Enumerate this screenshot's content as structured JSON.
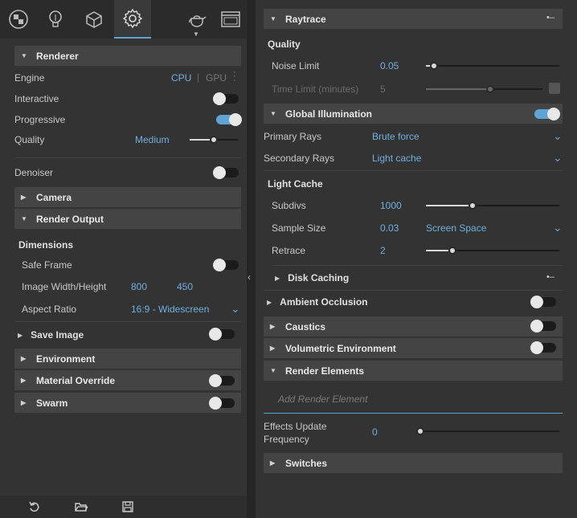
{
  "toolbar": {
    "items": [
      {
        "name": "materials"
      },
      {
        "name": "lights"
      },
      {
        "name": "geometry"
      },
      {
        "name": "settings"
      },
      {
        "name": "teapot"
      },
      {
        "name": "frame-buffer"
      }
    ]
  },
  "left": {
    "renderer": {
      "title": "Renderer",
      "engine_label": "Engine",
      "engine_cpu": "CPU",
      "engine_sep": "|",
      "engine_gpu": "GPU",
      "interactive_label": "Interactive",
      "interactive_on": false,
      "progressive_label": "Progressive",
      "progressive_on": true,
      "quality_label": "Quality",
      "quality_value": "Medium",
      "quality_level": 0.5,
      "denoiser_label": "Denoiser",
      "denoiser_on": false
    },
    "camera": {
      "title": "Camera"
    },
    "render_output": {
      "title": "Render Output",
      "dimensions_label": "Dimensions",
      "safe_frame_label": "Safe Frame",
      "safe_frame_on": false,
      "image_wh_label": "Image Width/Height",
      "width": "800",
      "height": "450",
      "aspect_label": "Aspect Ratio",
      "aspect_value": "16:9 - Widescreen"
    },
    "save_image": {
      "title": "Save Image",
      "on": false
    },
    "environment": {
      "title": "Environment"
    },
    "material_override": {
      "title": "Material Override",
      "on": false
    },
    "swarm": {
      "title": "Swarm",
      "on": false
    }
  },
  "right": {
    "raytrace": {
      "title": "Raytrace",
      "quality_label": "Quality",
      "noise_limit_label": "Noise Limit",
      "noise_limit_value": "0.05",
      "noise_limit_level": 0.06,
      "time_limit_label": "Time Limit (minutes)",
      "time_limit_value": "5",
      "time_limit_level": 0.55
    },
    "gi": {
      "title": "Global Illumination",
      "on": true,
      "primary_label": "Primary Rays",
      "primary_value": "Brute force",
      "secondary_label": "Secondary Rays",
      "secondary_value": "Light cache",
      "light_cache_label": "Light Cache",
      "subdivs_label": "Subdivs",
      "subdivs_value": "1000",
      "subdivs_level": 0.35,
      "sample_size_label": "Sample Size",
      "sample_size_value": "0.03",
      "sample_space_value": "Screen Space",
      "retrace_label": "Retrace",
      "retrace_value": "2",
      "retrace_level": 0.2,
      "disk_caching_title": "Disk Caching"
    },
    "ambient_occlusion": {
      "title": "Ambient Occlusion",
      "on": false
    },
    "caustics": {
      "title": "Caustics",
      "on": false
    },
    "volumetric": {
      "title": "Volumetric Environment",
      "on": false
    },
    "render_elements": {
      "title": "Render Elements",
      "placeholder": "Add Render Element"
    },
    "effects": {
      "label_line1": "Effects Update",
      "label_line2": "Frequency",
      "value": "0",
      "level": 0.0
    },
    "switches": {
      "title": "Switches"
    }
  },
  "colors": {
    "accent": "#5ea5d6",
    "panel": "#333333",
    "header": "#444444"
  }
}
